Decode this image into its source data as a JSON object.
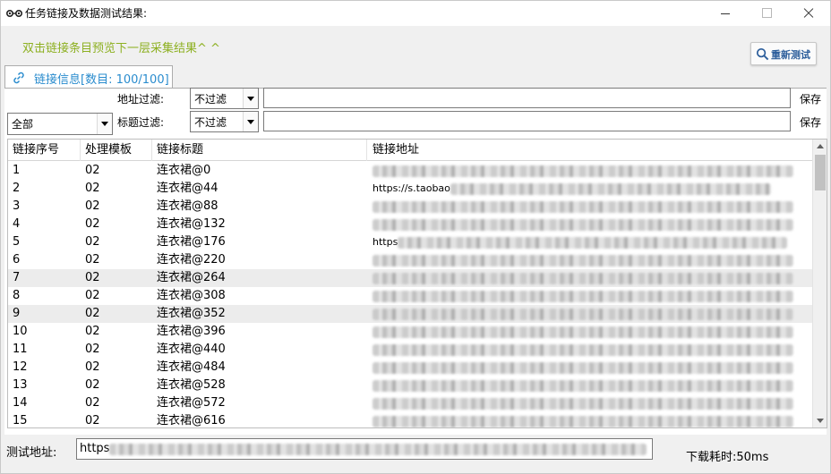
{
  "window": {
    "title": "任务链接及数据测试结果:",
    "icon": "glasses-icon"
  },
  "hint": "双击链接条目预览下一层采集结果^ ^",
  "retest_button": "重新测试",
  "tab": {
    "label": "链接信息[数目: 100/100]",
    "icon": "link-icon"
  },
  "filters": {
    "category_select": "全部",
    "url_filter_label": "地址过滤:",
    "url_filter_mode": "不过滤",
    "url_filter_value": "",
    "title_filter_label": "标题过滤:",
    "title_filter_mode": "不过滤",
    "title_filter_value": "",
    "save_label": "保存"
  },
  "table": {
    "columns": [
      "链接序号",
      "处理模板",
      "链接标题",
      "链接地址"
    ],
    "rows": [
      {
        "index": "1",
        "template": "02",
        "title": "连衣裙@0",
        "url_prefix": ""
      },
      {
        "index": "2",
        "template": "02",
        "title": "连衣裙@44",
        "url_prefix": "https://s.taobao"
      },
      {
        "index": "3",
        "template": "02",
        "title": "连衣裙@88",
        "url_prefix": ""
      },
      {
        "index": "4",
        "template": "02",
        "title": "连衣裙@132",
        "url_prefix": ""
      },
      {
        "index": "5",
        "template": "02",
        "title": "连衣裙@176",
        "url_prefix": "https"
      },
      {
        "index": "6",
        "template": "02",
        "title": "连衣裙@220",
        "url_prefix": ""
      },
      {
        "index": "7",
        "template": "02",
        "title": "连衣裙@264",
        "url_prefix": ""
      },
      {
        "index": "8",
        "template": "02",
        "title": "连衣裙@308",
        "url_prefix": ""
      },
      {
        "index": "9",
        "template": "02",
        "title": "连衣裙@352",
        "url_prefix": ""
      },
      {
        "index": "10",
        "template": "02",
        "title": "连衣裙@396",
        "url_prefix": ""
      },
      {
        "index": "11",
        "template": "02",
        "title": "连衣裙@440",
        "url_prefix": ""
      },
      {
        "index": "12",
        "template": "02",
        "title": "连衣裙@484",
        "url_prefix": ""
      },
      {
        "index": "13",
        "template": "02",
        "title": "连衣裙@528",
        "url_prefix": ""
      },
      {
        "index": "14",
        "template": "02",
        "title": "连衣裙@572",
        "url_prefix": ""
      },
      {
        "index": "15",
        "template": "02",
        "title": "连衣裙@616",
        "url_prefix": ""
      }
    ],
    "highlighted_rows": [
      7,
      9
    ]
  },
  "bottom": {
    "test_url_label": "测试地址:",
    "test_url_prefix": "https",
    "download_time": "下载耗时:50ms"
  },
  "colors": {
    "hint": "#8db021",
    "tab_label": "#2a8cce",
    "retest_label": "#2a5c9a",
    "highlight_row": "#ececec"
  }
}
